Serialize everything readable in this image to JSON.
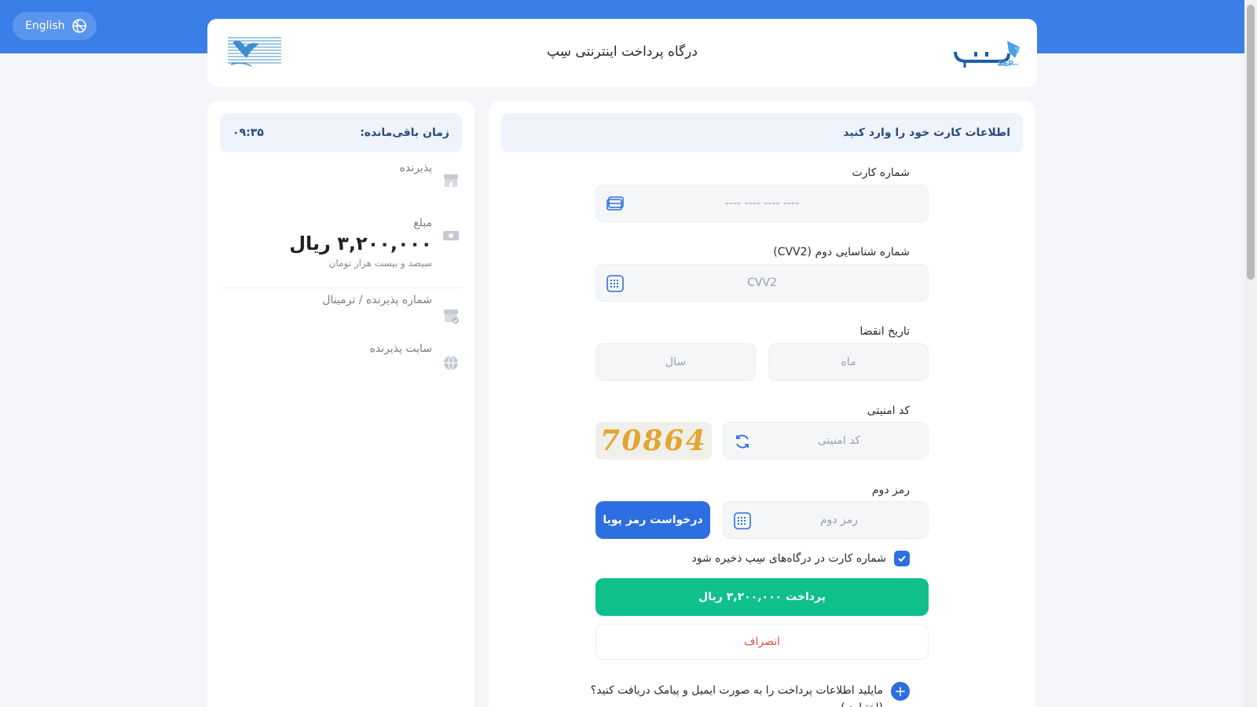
{
  "header": {
    "title": "درگاه پرداخت اینترنتی سِپ",
    "language_button": "English"
  },
  "sidebar": {
    "timer_label": "زمان باقی‌مانده:",
    "timer_value": "۰۹:۳۵",
    "merchant_label": "پذیرنده",
    "amount_label": "مبلغ",
    "amount_value": "۳,۲۰۰,۰۰۰ ریال",
    "amount_words": "سیصد و بیست هزار تومان",
    "terminal_label": "شماره پذیرنده / ترمینال",
    "site_label": "سایت پذیرنده"
  },
  "form": {
    "header": "اطلاعات کارت خود را وارد کنید",
    "card_number_label": "شماره کارت",
    "card_number_placeholder": "---- ---- ---- ----",
    "cvv2_label": "شماره شناسایی دوم (CVV2)",
    "cvv2_placeholder": "CVV2",
    "expiry_label": "تاریخ انقضا",
    "month_placeholder": "ماه",
    "year_placeholder": "سال",
    "captcha_label": "کد امنیتی",
    "captcha_placeholder": "کد امنیتی",
    "captcha_text": "70864",
    "otp_label": "رمز دوم",
    "otp_placeholder": "رمز دوم",
    "otp_button": "درخواست رمز پویا",
    "save_card_label": "شماره کارت در درگاه‌های سِپ ذخیره شود",
    "save_card_checked": true,
    "pay_button": "پرداخت ۳,۲۰۰,۰۰۰ ریال",
    "cancel_button": "انصراف",
    "optional_info": "مایلید اطلاعات پرداخت را به صورت ایمیل و پیامک دریافت کنید؟ (اختیاری)"
  },
  "colors": {
    "brand_blue": "#3a7fe8",
    "primary_button": "#2d6fe0",
    "pay_green": "#0fc08c",
    "cancel_red": "#e24d4d"
  }
}
